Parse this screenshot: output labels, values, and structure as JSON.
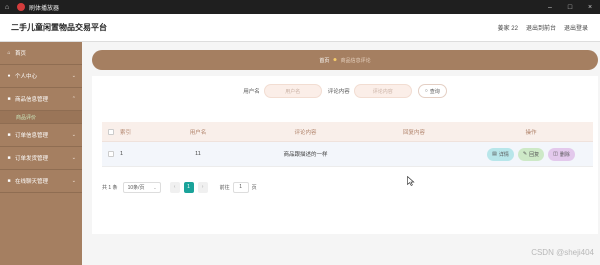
{
  "window": {
    "title": "刷体播放器",
    "home_icon": "home-icon",
    "app_icon": "player-icon",
    "controls": [
      "–",
      "□",
      "×"
    ]
  },
  "header": {
    "site_title": "二手儿童闲置物品交易平台",
    "links": [
      "姜家 22",
      "退出到前台",
      "退出登录"
    ]
  },
  "sidebar": {
    "items": [
      {
        "label": "首页",
        "icon": "home-icon",
        "has_arrow": false
      },
      {
        "label": "个人中心",
        "icon": "user-icon",
        "has_arrow": true
      },
      {
        "label": "商品信息管理",
        "icon": "folder-icon",
        "has_arrow": true
      },
      {
        "label": "订单信息管理",
        "icon": "folder-icon",
        "has_arrow": true
      },
      {
        "label": "订单发货管理",
        "icon": "folder-icon",
        "has_arrow": true
      },
      {
        "label": "在线聊天管理",
        "icon": "folder-icon",
        "has_arrow": true
      }
    ],
    "sub_item": "商品评价"
  },
  "breadcrumb": {
    "home": "首页",
    "separator_icon": "emoji-icon",
    "current": "商品信息评论"
  },
  "search": {
    "user_label": "用户名",
    "user_placeholder": "用户名",
    "comment_label": "评论内容",
    "comment_placeholder": "评论内容",
    "button_label": "查询"
  },
  "table": {
    "headers": [
      "索引",
      "用户名",
      "评论内容",
      "回复内容",
      "操作"
    ],
    "rows": [
      {
        "index": "1",
        "user": "11",
        "comment": "商品跟描述的一样",
        "reply": ""
      }
    ],
    "actions": {
      "detail": "详情",
      "reply": "回复",
      "delete": "删除"
    }
  },
  "pager": {
    "total": "共 1 条",
    "page_size": "10条/页",
    "current_page": "1",
    "goto_label": "前往",
    "goto_value": "1",
    "page_unit": "页"
  },
  "watermark": "CSDN @sheji404",
  "colors": {
    "sidebar": "#a57f61",
    "accent": "#1aa39a",
    "detail": "#b8e6ea",
    "reply": "#cde9c7",
    "delete": "#e3c9ec"
  }
}
